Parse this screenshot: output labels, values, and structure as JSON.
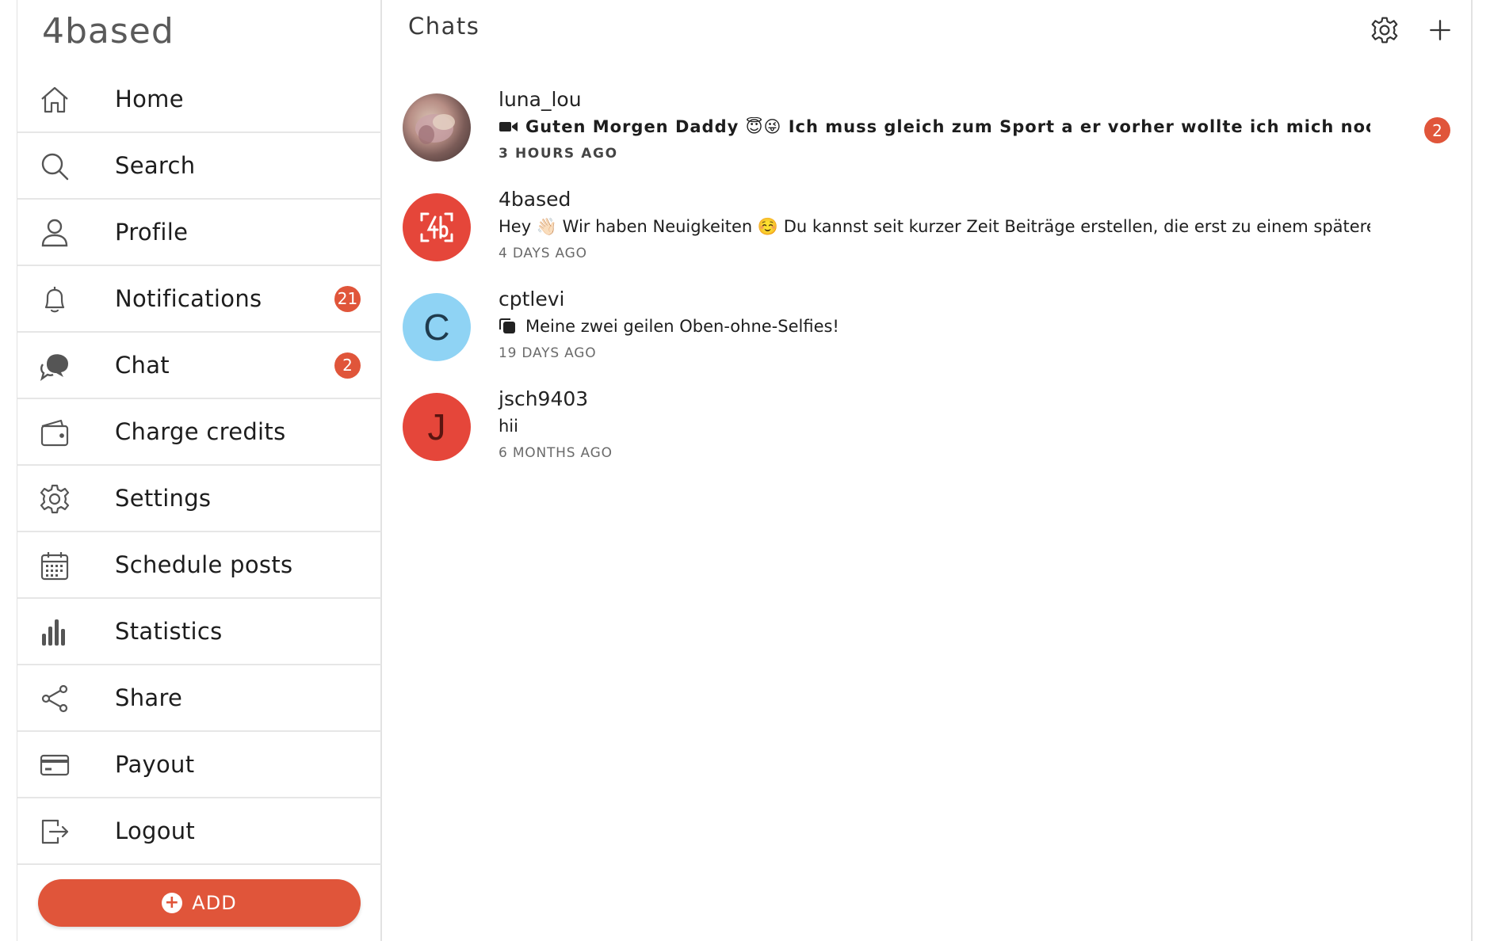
{
  "app": {
    "logo": "4based",
    "accent": "#e0553a"
  },
  "sidebar": {
    "items": [
      {
        "label": "Home",
        "icon": "home-icon"
      },
      {
        "label": "Search",
        "icon": "search-icon"
      },
      {
        "label": "Profile",
        "icon": "user-icon"
      },
      {
        "label": "Notifications",
        "icon": "bell-icon",
        "badge": "21"
      },
      {
        "label": "Chat",
        "icon": "chat-bubbles-icon",
        "badge": "2"
      },
      {
        "label": "Charge credits",
        "icon": "wallet-icon"
      },
      {
        "label": "Settings",
        "icon": "gear-icon"
      },
      {
        "label": "Schedule posts",
        "icon": "calendar-icon"
      },
      {
        "label": "Statistics",
        "icon": "bar-chart-icon"
      },
      {
        "label": "Share",
        "icon": "share-icon"
      },
      {
        "label": "Payout",
        "icon": "credit-card-icon"
      },
      {
        "label": "Logout",
        "icon": "logout-icon"
      }
    ],
    "add_button": "ADD"
  },
  "main": {
    "title": "Chats",
    "header_icons": [
      "gear-icon",
      "plus-icon"
    ],
    "chats": [
      {
        "name": "luna_lou",
        "message": "Guten Morgen Daddy 😇😜 Ich muss gleich zum Sport a er vorher wollte ich mich nochm…",
        "time": "3 HOURS AGO",
        "unread": "2",
        "message_icon": "video-camera-icon"
      },
      {
        "name": "4based",
        "message": "Hey 👋🏻 Wir haben Neuigkeiten ☺️ Du kannst seit kurzer Zeit Beiträge erstellen, die erst zu einem späteren Zeitpunk…",
        "time": "4 DAYS AGO"
      },
      {
        "name": "cptlevi",
        "message": "Meine zwei geilen Oben-ohne-Selfies!",
        "time": "19 DAYS AGO",
        "message_icon": "gallery-icon",
        "avatar_letter": "C",
        "avatar_color": "#8fd3f4"
      },
      {
        "name": "jsch9403",
        "message": "hii",
        "time": "6 MONTHS AGO",
        "avatar_letter": "J",
        "avatar_color": "#e5463a"
      }
    ]
  }
}
